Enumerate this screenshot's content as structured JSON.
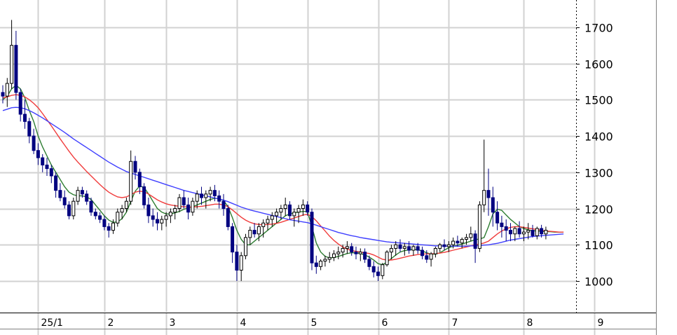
{
  "chart_data": {
    "type": "candlestick",
    "title": "",
    "xlabel": "",
    "ylabel": "",
    "ylim": [
      915,
      1775
    ],
    "yticks": [
      1000,
      1100,
      1200,
      1300,
      1400,
      1500,
      1600,
      1700
    ],
    "month_ticks": [
      {
        "label": "25/1",
        "index": 8
      },
      {
        "label": "2",
        "index": 23
      },
      {
        "label": "3",
        "index": 37
      },
      {
        "label": "4",
        "index": 53
      },
      {
        "label": "5",
        "index": 69
      },
      {
        "label": "6",
        "index": 85
      },
      {
        "label": "7",
        "index": 101
      },
      {
        "label": "8",
        "index": 118
      },
      {
        "label": "9",
        "index": 134
      }
    ],
    "grid": true,
    "colors": {
      "up": "#000000",
      "down": "#000080",
      "ma_short": "#2e7d32",
      "ma_mid": "#f03c3c",
      "ma_long": "#4040ff",
      "grid": "#d2d2d2",
      "axis": "#000000"
    },
    "candles": [
      [
        1520,
        1540,
        1490,
        1510
      ],
      [
        1510,
        1560,
        1480,
        1545
      ],
      [
        1545,
        1720,
        1530,
        1650
      ],
      [
        1650,
        1690,
        1500,
        1520
      ],
      [
        1520,
        1530,
        1440,
        1460
      ],
      [
        1460,
        1500,
        1420,
        1440
      ],
      [
        1440,
        1450,
        1380,
        1400
      ],
      [
        1400,
        1420,
        1350,
        1360
      ],
      [
        1360,
        1380,
        1320,
        1340
      ],
      [
        1340,
        1350,
        1300,
        1320
      ],
      [
        1320,
        1340,
        1290,
        1310
      ],
      [
        1310,
        1320,
        1270,
        1290
      ],
      [
        1290,
        1300,
        1230,
        1250
      ],
      [
        1250,
        1270,
        1220,
        1230
      ],
      [
        1230,
        1250,
        1200,
        1210
      ],
      [
        1210,
        1220,
        1170,
        1180
      ],
      [
        1180,
        1230,
        1170,
        1220
      ],
      [
        1220,
        1260,
        1210,
        1250
      ],
      [
        1250,
        1260,
        1230,
        1240
      ],
      [
        1240,
        1250,
        1210,
        1220
      ],
      [
        1220,
        1230,
        1180,
        1190
      ],
      [
        1190,
        1200,
        1170,
        1180
      ],
      [
        1180,
        1190,
        1160,
        1170
      ],
      [
        1170,
        1180,
        1140,
        1150
      ],
      [
        1150,
        1160,
        1120,
        1140
      ],
      [
        1140,
        1170,
        1130,
        1160
      ],
      [
        1160,
        1200,
        1150,
        1190
      ],
      [
        1190,
        1210,
        1170,
        1200
      ],
      [
        1200,
        1230,
        1190,
        1220
      ],
      [
        1220,
        1360,
        1210,
        1330
      ],
      [
        1330,
        1345,
        1280,
        1300
      ],
      [
        1300,
        1310,
        1240,
        1260
      ],
      [
        1260,
        1270,
        1200,
        1210
      ],
      [
        1210,
        1230,
        1160,
        1180
      ],
      [
        1180,
        1200,
        1150,
        1170
      ],
      [
        1170,
        1190,
        1140,
        1160
      ],
      [
        1160,
        1180,
        1140,
        1170
      ],
      [
        1170,
        1190,
        1150,
        1180
      ],
      [
        1180,
        1200,
        1160,
        1190
      ],
      [
        1190,
        1210,
        1170,
        1200
      ],
      [
        1200,
        1240,
        1190,
        1230
      ],
      [
        1230,
        1250,
        1200,
        1210
      ],
      [
        1210,
        1230,
        1170,
        1190
      ],
      [
        1190,
        1230,
        1180,
        1220
      ],
      [
        1220,
        1250,
        1200,
        1240
      ],
      [
        1240,
        1260,
        1210,
        1230
      ],
      [
        1230,
        1250,
        1200,
        1240
      ],
      [
        1240,
        1260,
        1220,
        1250
      ],
      [
        1250,
        1265,
        1220,
        1235
      ],
      [
        1235,
        1250,
        1200,
        1220
      ],
      [
        1220,
        1240,
        1180,
        1200
      ],
      [
        1200,
        1210,
        1140,
        1150
      ],
      [
        1150,
        1160,
        1050,
        1080
      ],
      [
        1080,
        1100,
        1000,
        1030
      ],
      [
        1030,
        1080,
        1000,
        1070
      ],
      [
        1070,
        1130,
        1060,
        1120
      ],
      [
        1120,
        1150,
        1100,
        1140
      ],
      [
        1140,
        1160,
        1120,
        1130
      ],
      [
        1130,
        1160,
        1110,
        1150
      ],
      [
        1150,
        1170,
        1120,
        1160
      ],
      [
        1160,
        1180,
        1140,
        1170
      ],
      [
        1170,
        1190,
        1150,
        1180
      ],
      [
        1180,
        1200,
        1160,
        1190
      ],
      [
        1190,
        1210,
        1170,
        1200
      ],
      [
        1200,
        1230,
        1180,
        1210
      ],
      [
        1210,
        1220,
        1170,
        1180
      ],
      [
        1180,
        1200,
        1150,
        1190
      ],
      [
        1190,
        1210,
        1160,
        1200
      ],
      [
        1200,
        1225,
        1180,
        1210
      ],
      [
        1210,
        1220,
        1180,
        1190
      ],
      [
        1190,
        1200,
        1030,
        1050
      ],
      [
        1050,
        1070,
        1020,
        1040
      ],
      [
        1040,
        1060,
        1030,
        1055
      ],
      [
        1055,
        1070,
        1040,
        1060
      ],
      [
        1060,
        1080,
        1050,
        1065
      ],
      [
        1065,
        1085,
        1055,
        1075
      ],
      [
        1075,
        1095,
        1060,
        1080
      ],
      [
        1080,
        1100,
        1065,
        1090
      ],
      [
        1090,
        1110,
        1075,
        1095
      ],
      [
        1095,
        1105,
        1070,
        1080
      ],
      [
        1080,
        1095,
        1060,
        1075
      ],
      [
        1075,
        1090,
        1055,
        1080
      ],
      [
        1080,
        1090,
        1050,
        1060
      ],
      [
        1060,
        1070,
        1030,
        1040
      ],
      [
        1040,
        1055,
        1010,
        1025
      ],
      [
        1025,
        1040,
        1000,
        1015
      ],
      [
        1015,
        1050,
        1005,
        1045
      ],
      [
        1045,
        1085,
        1040,
        1080
      ],
      [
        1080,
        1100,
        1060,
        1090
      ],
      [
        1090,
        1110,
        1070,
        1100
      ],
      [
        1100,
        1115,
        1080,
        1090
      ],
      [
        1090,
        1105,
        1070,
        1095
      ],
      [
        1095,
        1110,
        1075,
        1085
      ],
      [
        1085,
        1100,
        1070,
        1095
      ],
      [
        1095,
        1105,
        1075,
        1085
      ],
      [
        1085,
        1095,
        1060,
        1070
      ],
      [
        1070,
        1085,
        1050,
        1060
      ],
      [
        1060,
        1080,
        1040,
        1075
      ],
      [
        1075,
        1095,
        1065,
        1090
      ],
      [
        1090,
        1105,
        1080,
        1100
      ],
      [
        1100,
        1115,
        1085,
        1095
      ],
      [
        1095,
        1110,
        1080,
        1100
      ],
      [
        1100,
        1120,
        1090,
        1110
      ],
      [
        1110,
        1125,
        1095,
        1105
      ],
      [
        1105,
        1120,
        1090,
        1115
      ],
      [
        1115,
        1130,
        1100,
        1120
      ],
      [
        1120,
        1150,
        1110,
        1130
      ],
      [
        1130,
        1140,
        1050,
        1090
      ],
      [
        1090,
        1220,
        1080,
        1210
      ],
      [
        1210,
        1390,
        1190,
        1250
      ],
      [
        1250,
        1310,
        1180,
        1230
      ],
      [
        1230,
        1260,
        1150,
        1190
      ],
      [
        1190,
        1220,
        1140,
        1160
      ],
      [
        1160,
        1180,
        1120,
        1150
      ],
      [
        1150,
        1170,
        1110,
        1140
      ],
      [
        1140,
        1160,
        1110,
        1130
      ],
      [
        1130,
        1150,
        1110,
        1145
      ],
      [
        1145,
        1165,
        1120,
        1130
      ],
      [
        1130,
        1150,
        1110,
        1135
      ],
      [
        1135,
        1160,
        1115,
        1140
      ],
      [
        1140,
        1155,
        1120,
        1125
      ],
      [
        1125,
        1150,
        1115,
        1145
      ],
      [
        1145,
        1155,
        1120,
        1130
      ],
      [
        1130,
        1150,
        1115,
        1140
      ]
    ],
    "series": [
      {
        "key": "ma_short",
        "color": "#2e7d32",
        "values": [
          1500,
          1510,
          1530,
          1540,
          1530,
          1505,
          1470,
          1440,
          1400,
          1370,
          1345,
          1320,
          1300,
          1280,
          1260,
          1245,
          1238,
          1235,
          1235,
          1232,
          1225,
          1210,
          1195,
          1180,
          1168,
          1162,
          1163,
          1172,
          1190,
          1220,
          1248,
          1262,
          1258,
          1240,
          1220,
          1200,
          1190,
          1185,
          1185,
          1188,
          1192,
          1198,
          1202,
          1205,
          1210,
          1215,
          1220,
          1225,
          1228,
          1227,
          1222,
          1205,
          1175,
          1140,
          1115,
          1100,
          1100,
          1110,
          1120,
          1130,
          1140,
          1150,
          1160,
          1170,
          1180,
          1185,
          1188,
          1190,
          1192,
          1192,
          1150,
          1105,
          1080,
          1068,
          1064,
          1065,
          1068,
          1072,
          1076,
          1078,
          1078,
          1076,
          1072,
          1066,
          1058,
          1048,
          1045,
          1052,
          1062,
          1072,
          1080,
          1084,
          1086,
          1087,
          1086,
          1083,
          1078,
          1074,
          1074,
          1078,
          1085,
          1092,
          1096,
          1099,
          1102,
          1106,
          1110,
          1114,
          1116,
          1120,
          1150,
          1185,
          1198,
          1195,
          1182,
          1170,
          1160,
          1150,
          1145,
          1141,
          1139,
          1138,
          1137,
          1136,
          1136,
          1135,
          1135,
          1135
        ]
      },
      {
        "key": "ma_mid",
        "color": "#f03c3c",
        "values": [
          1505,
          1508,
          1512,
          1514,
          1512,
          1508,
          1500,
          1490,
          1478,
          1462,
          1445,
          1428,
          1410,
          1392,
          1375,
          1358,
          1342,
          1328,
          1315,
          1302,
          1290,
          1278,
          1266,
          1255,
          1245,
          1238,
          1232,
          1230,
          1232,
          1238,
          1245,
          1248,
          1246,
          1240,
          1232,
          1224,
          1218,
          1213,
          1210,
          1208,
          1206,
          1205,
          1204,
          1204,
          1205,
          1206,
          1208,
          1210,
          1212,
          1212,
          1210,
          1205,
          1196,
          1186,
          1176,
          1168,
          1162,
          1158,
          1156,
          1155,
          1156,
          1157,
          1159,
          1162,
          1166,
          1170,
          1174,
          1178,
          1182,
          1184,
          1178,
          1166,
          1152,
          1138,
          1124,
          1112,
          1102,
          1094,
          1088,
          1084,
          1082,
          1080,
          1078,
          1076,
          1072,
          1066,
          1060,
          1058,
          1058,
          1060,
          1063,
          1066,
          1069,
          1071,
          1073,
          1074,
          1075,
          1075,
          1076,
          1077,
          1079,
          1082,
          1085,
          1088,
          1091,
          1094,
          1097,
          1100,
          1102,
          1105,
          1110,
          1120,
          1130,
          1138,
          1144,
          1148,
          1150,
          1150,
          1148,
          1146,
          1144,
          1142,
          1140,
          1138,
          1137,
          1136,
          1135,
          1135
        ]
      },
      {
        "key": "ma_long",
        "color": "#4040ff",
        "values": [
          1470,
          1474,
          1478,
          1479,
          1478,
          1475,
          1470,
          1464,
          1457,
          1450,
          1442,
          1434,
          1426,
          1418,
          1410,
          1401,
          1392,
          1384,
          1376,
          1368,
          1360,
          1352,
          1344,
          1336,
          1328,
          1321,
          1314,
          1308,
          1302,
          1298,
          1294,
          1290,
          1286,
          1282,
          1278,
          1274,
          1270,
          1266,
          1262,
          1258,
          1254,
          1250,
          1247,
          1244,
          1241,
          1238,
          1235,
          1232,
          1229,
          1226,
          1223,
          1219,
          1214,
          1209,
          1204,
          1200,
          1196,
          1193,
          1190,
          1187,
          1184,
          1181,
          1178,
          1175,
          1172,
          1169,
          1167,
          1165,
          1163,
          1161,
          1158,
          1154,
          1150,
          1146,
          1142,
          1138,
          1134,
          1131,
          1128,
          1125,
          1123,
          1120,
          1118,
          1116,
          1114,
          1112,
          1110,
          1108,
          1107,
          1106,
          1105,
          1104,
          1103,
          1102,
          1101,
          1100,
          1099,
          1098,
          1097,
          1097,
          1096,
          1096,
          1096,
          1096,
          1096,
          1096,
          1097,
          1097,
          1098,
          1099,
          1100,
          1102,
          1104,
          1107,
          1110,
          1113,
          1115,
          1117,
          1119,
          1121,
          1123,
          1124,
          1125,
          1126,
          1127,
          1128,
          1129,
          1130
        ]
      }
    ]
  }
}
